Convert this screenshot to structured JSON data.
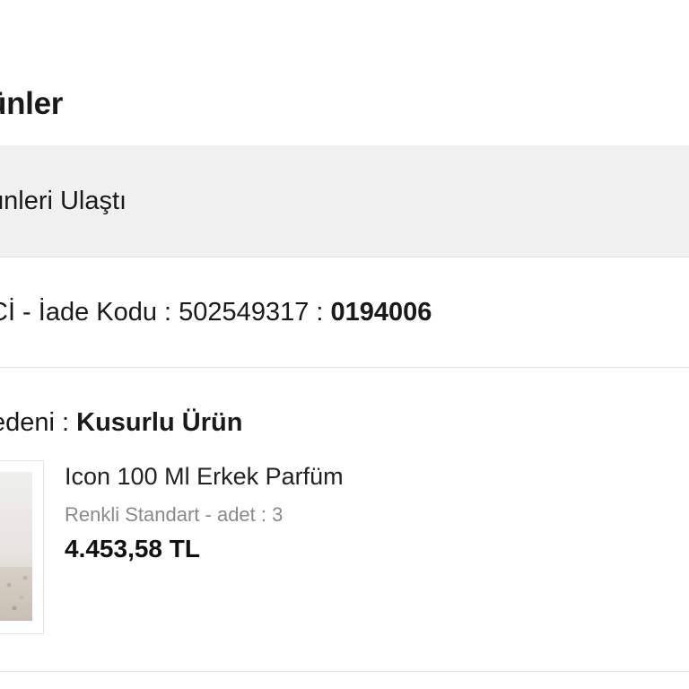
{
  "section_title": "ünler",
  "status_message": "ünleri Ulaştı",
  "return_info": {
    "prefix": "Cİ - İade Kodu : 502549317 : ",
    "code": "0194006"
  },
  "return_reason": {
    "label": "edeni : ",
    "value": "Kusurlu Ürün"
  },
  "product": {
    "name": "Icon 100 Ml Erkek Parfüm",
    "variant": "Renkli Standart - adet : 3",
    "price": "4.453,58 TL"
  }
}
